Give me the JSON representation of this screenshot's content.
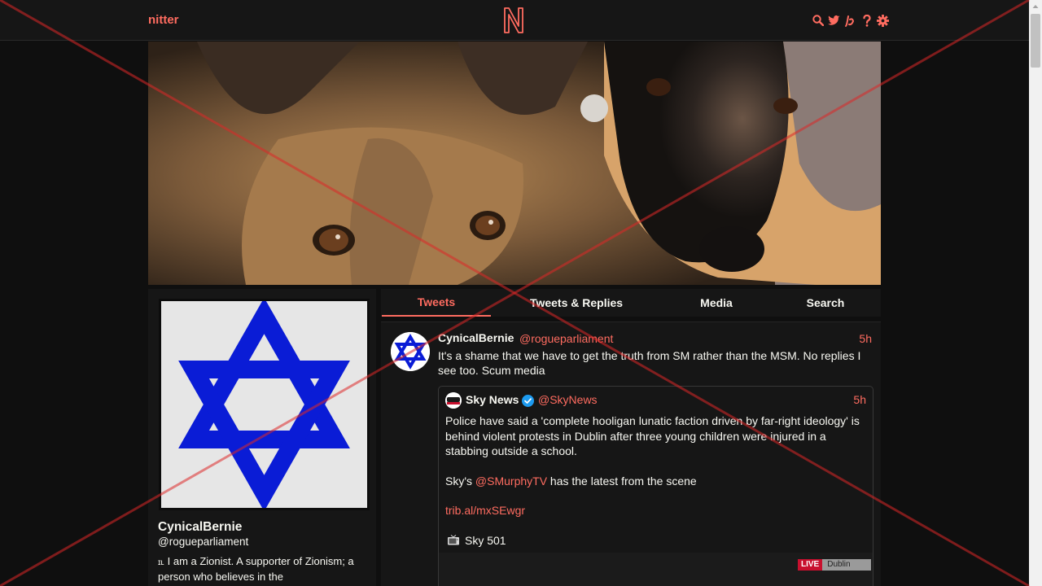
{
  "nav": {
    "brand": "nitter",
    "icons": [
      "search-icon",
      "twitter-icon",
      "rss-icon",
      "help-icon",
      "settings-icon"
    ]
  },
  "profile": {
    "fullname": "CynicalBernie",
    "username": "@rogueparliament",
    "bio": "I am a  Zionist. A supporter of Zionism; a person who believes in the"
  },
  "tabs": [
    "Tweets",
    "Tweets & Replies",
    "Media",
    "Search"
  ],
  "tweet": {
    "fullname": "CynicalBernie",
    "username": "@rogueparliament",
    "date": "5h",
    "text": "It's a shame that we have to get the truth from SM rather than the MSM. No replies I see too. Scum media",
    "quote": {
      "fullname": "Sky News",
      "username": "@SkyNews",
      "date": "5h",
      "body_1": "Police have said a 'complete hooligan lunatic faction driven by far-right ideology' is behind violent protests in Dublin after three young children were injured in a stabbing outside a school.",
      "body_2_prefix": "Sky's ",
      "body_2_mention": "@SMurphyTV",
      "body_2_suffix": " has the latest from the scene",
      "link": "trib.al/mxSEwgr",
      "channel": "Sky 501",
      "live_label": "LIVE",
      "live_location": "Dublin"
    }
  },
  "colors": {
    "accent": "#ff6c60",
    "background": "#0f0f0f",
    "panel": "#161616",
    "star": "#0a1cd6"
  }
}
